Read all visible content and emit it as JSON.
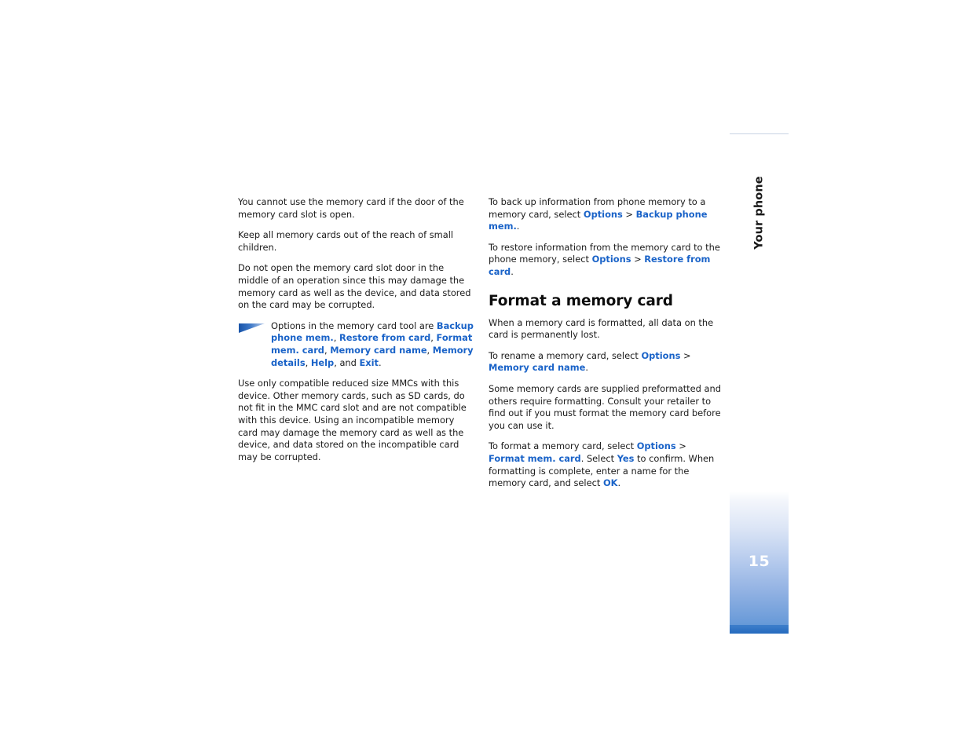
{
  "document": {
    "chapter_tab_label": "Your phone",
    "page_number": "15",
    "accent_color": "#1a63c8",
    "tab_bottom_color": "#2369bd"
  },
  "icons": {
    "note_wedge": "note-wedge-icon"
  },
  "left_column": {
    "paragraphs": [
      "You cannot use the memory card if the door of the memory card slot is open.",
      "Keep all memory cards out of the reach of small children.",
      "Do not open the memory card slot door in the middle of an operation since this may damage the memory card as well as the device, and data stored on the card may be corrupted."
    ],
    "note": {
      "lead": "Options in the memory card tool are ",
      "items": [
        "Backup phone mem.",
        "Restore from card",
        "Format mem. card",
        "Memory card name",
        "Memory details",
        "Help",
        "Exit"
      ],
      "sep_comma": ", ",
      "sep_and": " and ",
      "terminator": "."
    },
    "closing_paragraph": "Use only compatible reduced size MMCs with this device. Other memory cards, such as SD cards, do not fit in the MMC card slot and are not compatible with this device. Using an incompatible memory card may damage the memory card as well as the device, and data stored on the incompatible card may be corrupted."
  },
  "right_column": {
    "backup": {
      "text_before": "To back up information from phone memory to a memory card, select ",
      "menu": "Options",
      "separator": " > ",
      "command": "Backup phone mem.",
      "text_after": "."
    },
    "restore": {
      "text_before": "To restore information from the memory card to the phone memory, select ",
      "menu": "Options",
      "separator": " > ",
      "command": "Restore from card",
      "text_after": "."
    },
    "heading": "Format a memory card",
    "warning": "When a memory card is formatted, all data on the card is permanently lost.",
    "rename": {
      "text_before": "To rename a memory card, select ",
      "menu": "Options",
      "separator": " > ",
      "command": "Memory card name",
      "text_after": "."
    },
    "preformatted": "Some memory cards are supplied preformatted and others require formatting. Consult your retailer to find out if you must format the memory card before you can use it.",
    "format": {
      "text_before": "To format a memory card, select ",
      "menu": "Options",
      "separator": " > ",
      "command": "Format mem. card",
      "mid_1": ". Select ",
      "confirm": "Yes",
      "mid_2": " to confirm. When formatting is complete, enter a name for the memory card, and select ",
      "ok": "OK",
      "text_after": "."
    }
  }
}
